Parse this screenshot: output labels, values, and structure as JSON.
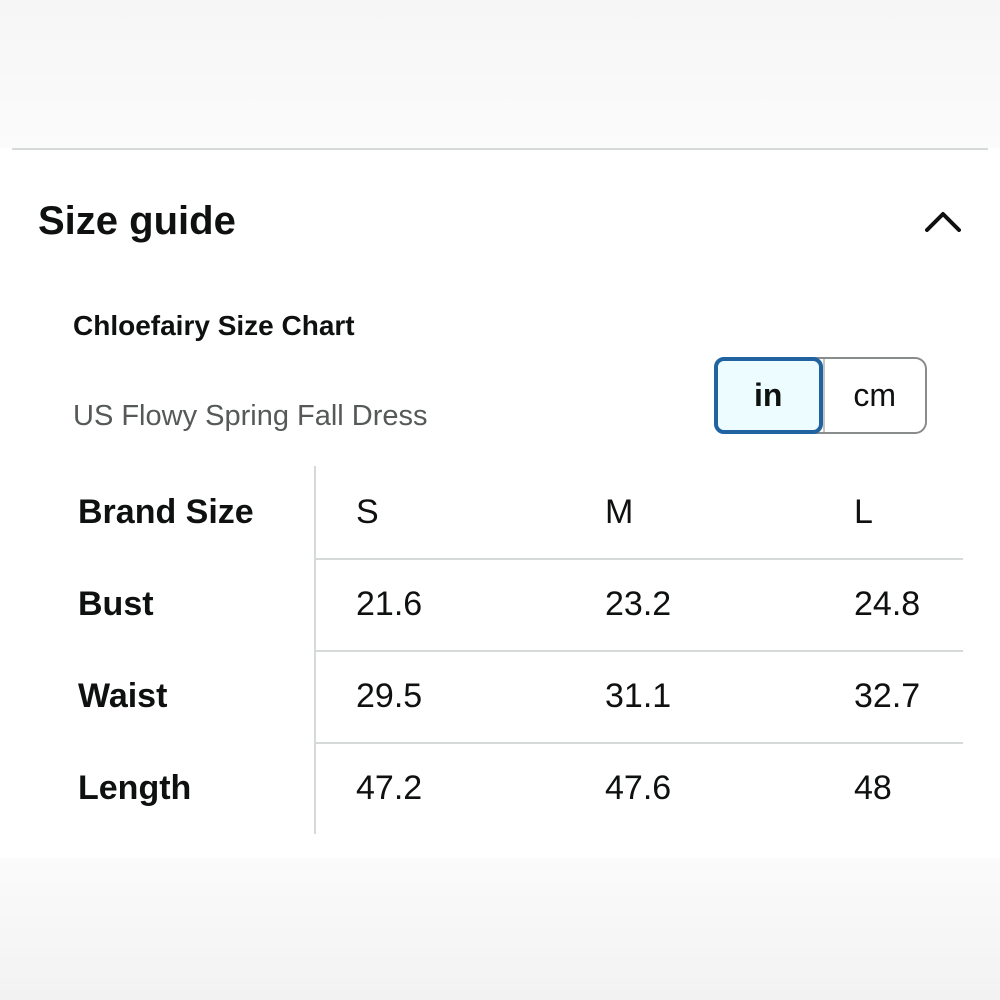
{
  "header": {
    "title": "Size guide",
    "collapse_icon": "chevron-up-icon"
  },
  "chart": {
    "title": "Chloefairy Size Chart",
    "subtitle": "US Flowy Spring Fall Dress"
  },
  "unit_toggle": {
    "options": [
      "in",
      "cm"
    ],
    "selected": "in"
  },
  "table": {
    "header_label": "Brand Size",
    "sizes": [
      "S",
      "M",
      "L"
    ],
    "rows": [
      {
        "label": "Bust",
        "values": [
          "21.6",
          "23.2",
          "24.8"
        ]
      },
      {
        "label": "Waist",
        "values": [
          "29.5",
          "31.1",
          "32.7"
        ]
      },
      {
        "label": "Length",
        "values": [
          "47.2",
          "47.6",
          "48"
        ]
      }
    ]
  },
  "colors": {
    "active_border": "#2162a1",
    "active_bg": "#edfdff",
    "text": "#0f1111",
    "muted_text": "#565959",
    "divider": "#d5d9d9"
  }
}
